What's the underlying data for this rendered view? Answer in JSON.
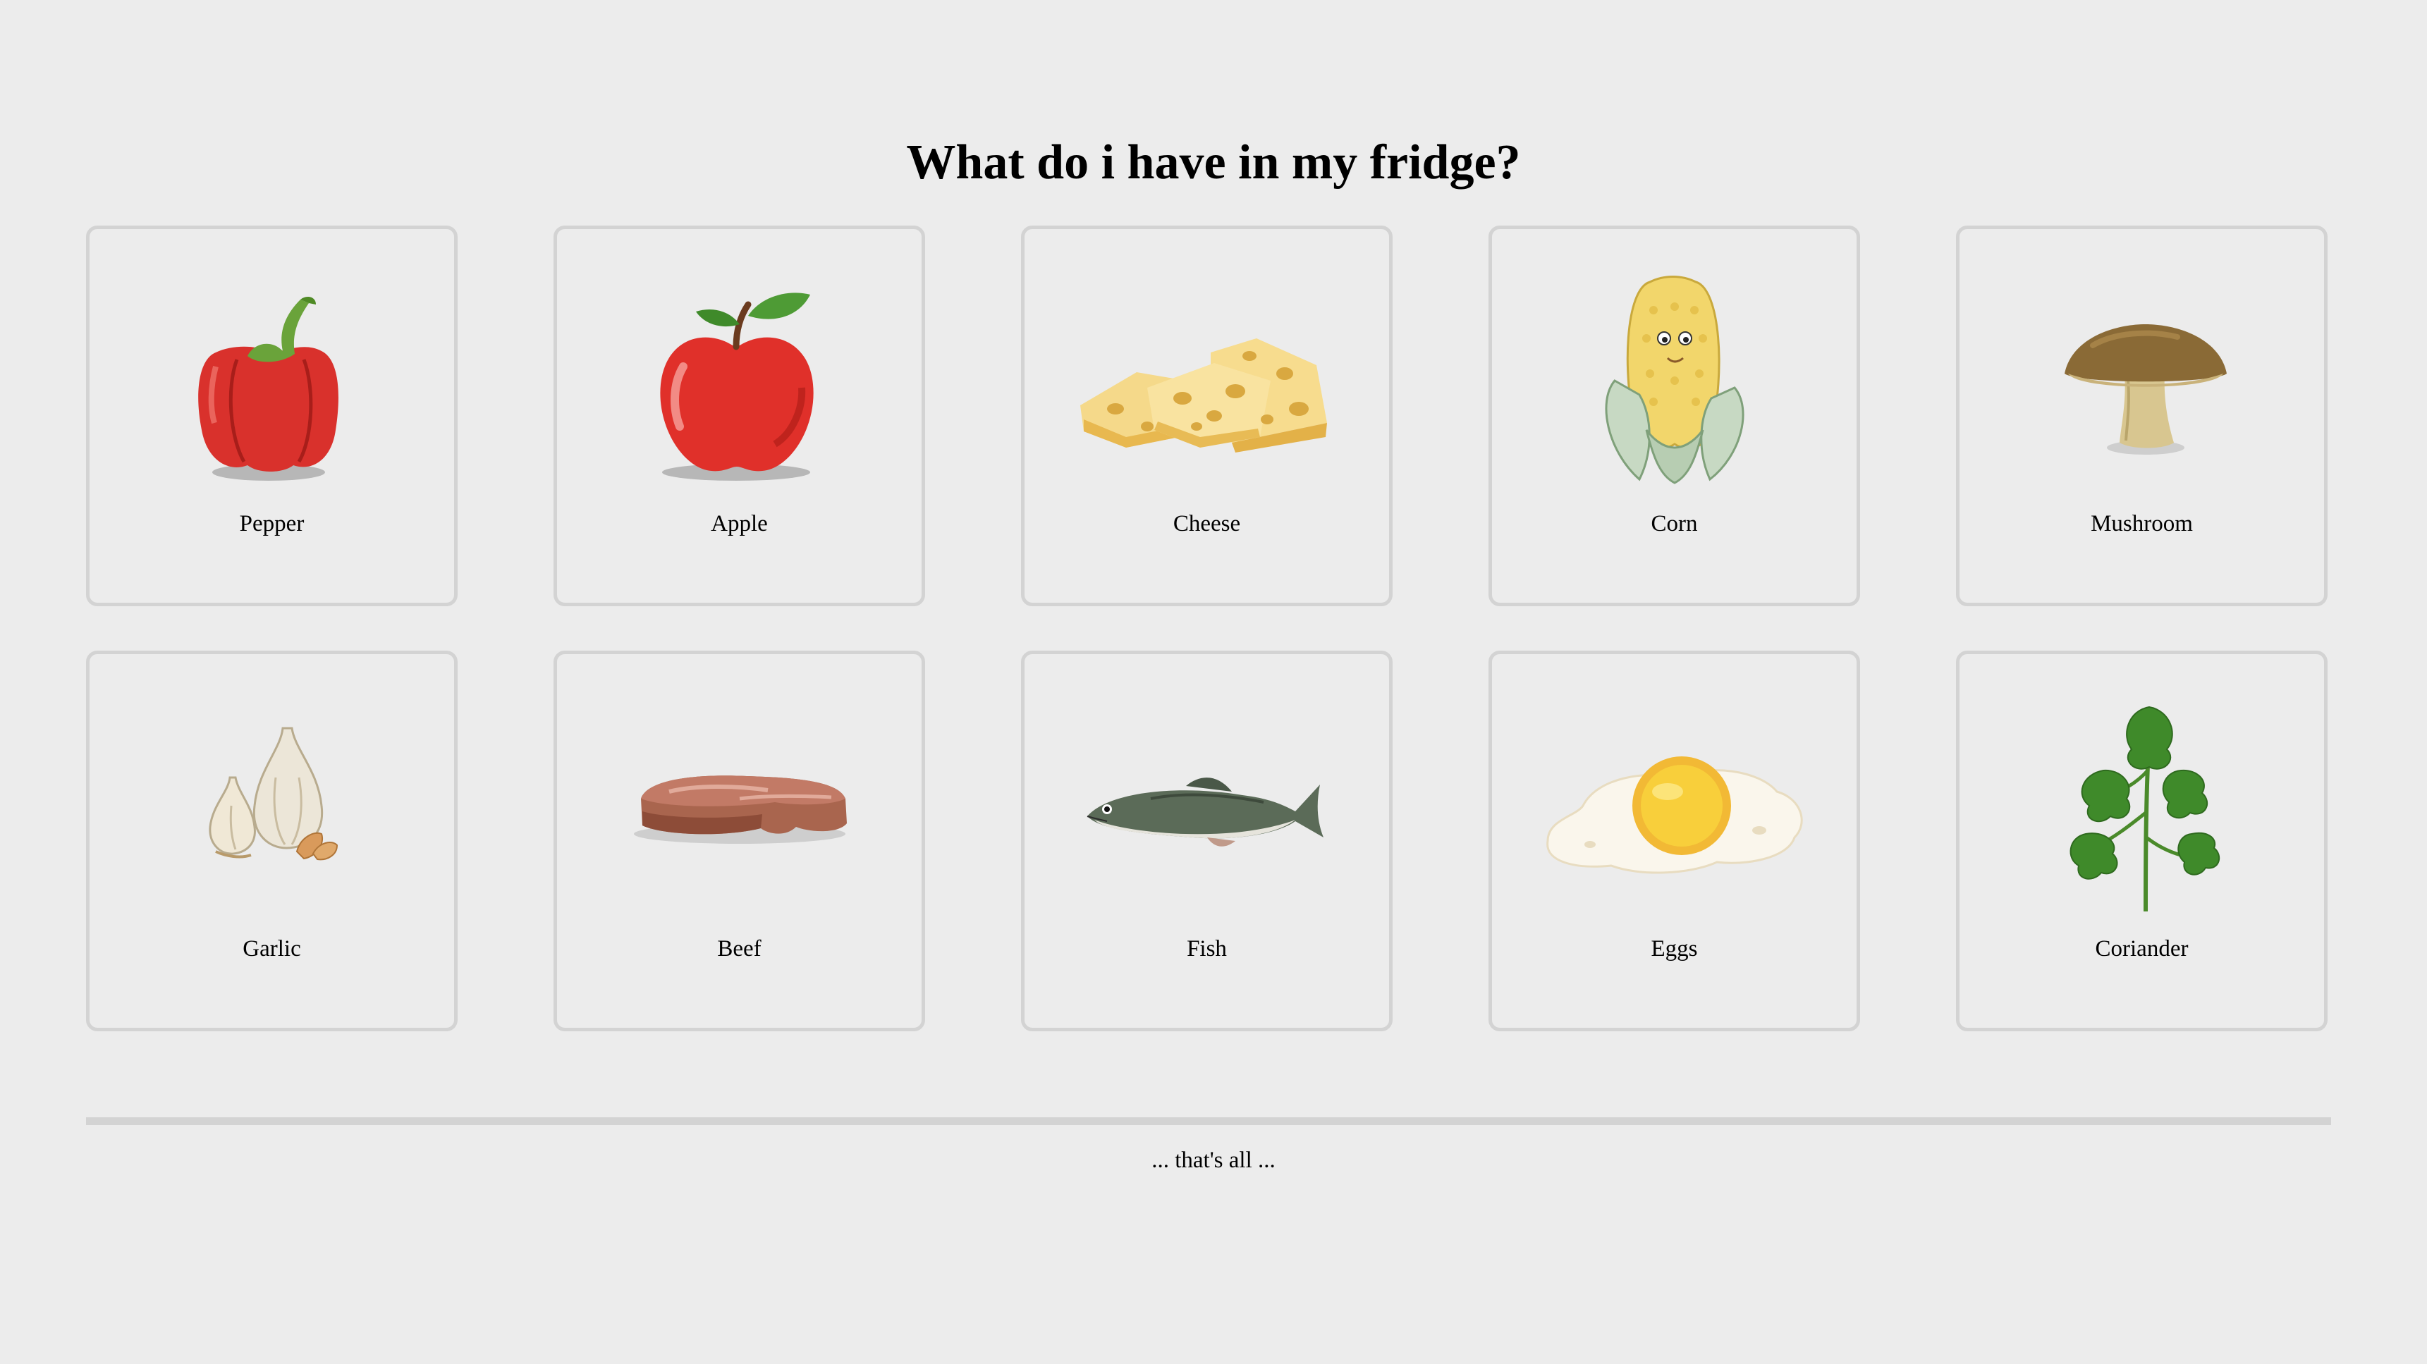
{
  "header": {
    "title": "What do i have in my fridge?"
  },
  "items": [
    {
      "label": "Pepper",
      "icon": "pepper-icon"
    },
    {
      "label": "Apple",
      "icon": "apple-icon"
    },
    {
      "label": "Cheese",
      "icon": "cheese-icon"
    },
    {
      "label": "Corn",
      "icon": "corn-icon"
    },
    {
      "label": "Mushroom",
      "icon": "mushroom-icon"
    },
    {
      "label": "Garlic",
      "icon": "garlic-icon"
    },
    {
      "label": "Beef",
      "icon": "beef-icon"
    },
    {
      "label": "Fish",
      "icon": "fish-icon"
    },
    {
      "label": "Eggs",
      "icon": "egg-icon"
    },
    {
      "label": "Coriander",
      "icon": "coriander-icon"
    }
  ],
  "footer": {
    "note": "... that's all ..."
  },
  "colors": {
    "background": "#ececec",
    "card_border": "#d3d3d3",
    "text": "#000000"
  }
}
